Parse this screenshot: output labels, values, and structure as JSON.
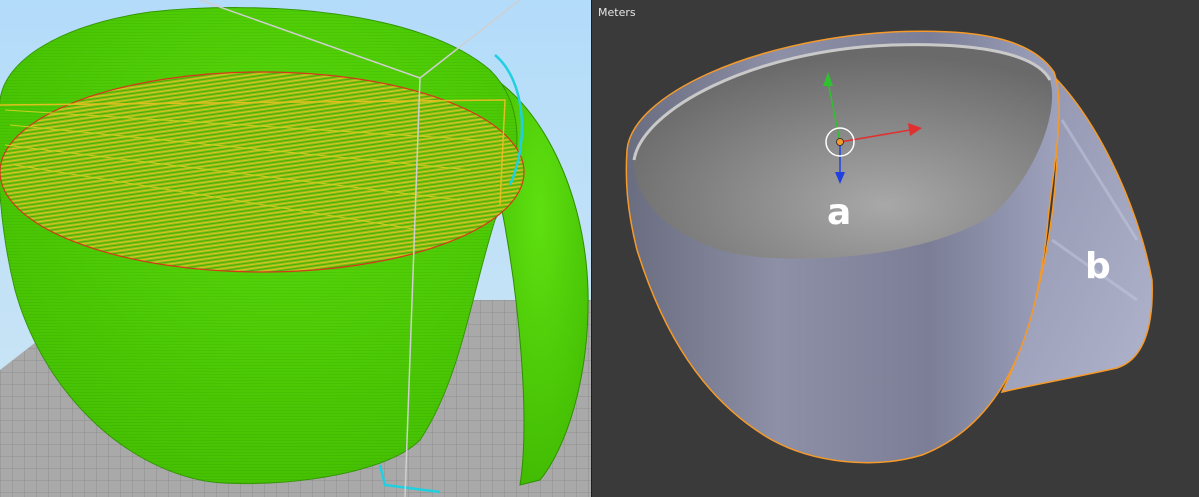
{
  "slicer_view": {
    "model_color": "#4ccc00",
    "background_color": "#9fcdee",
    "bed_color": "#a9a9a9"
  },
  "blender_view": {
    "units_label": "Meters",
    "annotation_a": "a",
    "annotation_b": "b",
    "background_color": "#3a3a3a",
    "selection_outline_color": "#f59a2a",
    "axis_colors": {
      "x": "#e03030",
      "y": "#30c030",
      "z": "#2040e0"
    }
  }
}
